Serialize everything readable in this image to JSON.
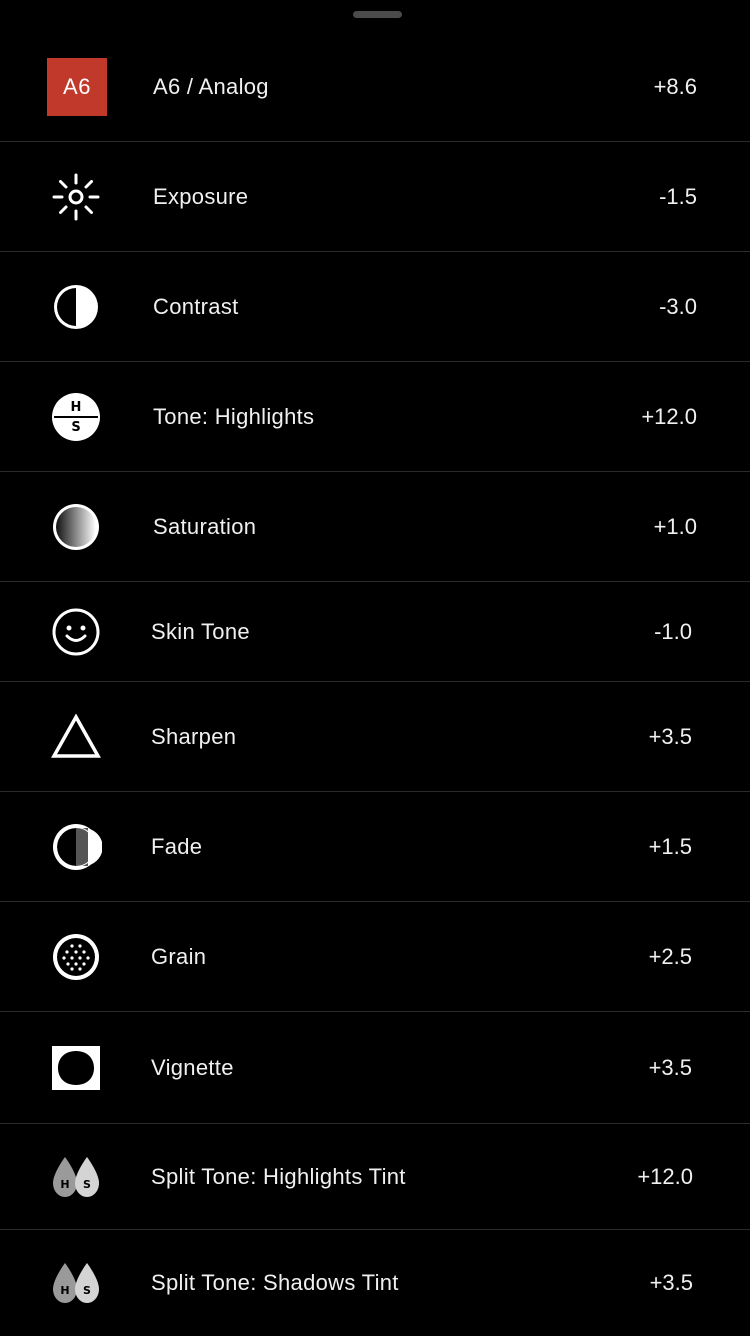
{
  "preset": {
    "badge": "A6",
    "label": "A6 / Analog",
    "value": "+8.6",
    "badge_color": "#c0392b"
  },
  "tools": [
    {
      "icon": "exposure-icon",
      "label": "Exposure",
      "value": "-1.5"
    },
    {
      "icon": "contrast-icon",
      "label": "Contrast",
      "value": "-3.0"
    },
    {
      "icon": "tone-icon",
      "label": "Tone: Highlights",
      "value": "+12.0",
      "icon_text_top": "H",
      "icon_text_bottom": "S"
    },
    {
      "icon": "saturation-icon",
      "label": "Saturation",
      "value": "+1.0"
    },
    {
      "icon": "skin-tone-icon",
      "label": "Skin Tone",
      "value": "-1.0"
    },
    {
      "icon": "sharpen-icon",
      "label": "Sharpen",
      "value": "+3.5"
    },
    {
      "icon": "fade-icon",
      "label": "Fade",
      "value": "+1.5"
    },
    {
      "icon": "grain-icon",
      "label": "Grain",
      "value": "+2.5"
    },
    {
      "icon": "vignette-icon",
      "label": "Vignette",
      "value": "+3.5"
    },
    {
      "icon": "split-tone-icon",
      "label": "Split Tone: Highlights Tint",
      "value": "+12.0",
      "icon_text_left": "H",
      "icon_text_right": "S"
    },
    {
      "icon": "split-tone-icon",
      "label": "Split Tone: Shadows Tint",
      "value": "+3.5",
      "icon_text_left": "H",
      "icon_text_right": "S"
    }
  ]
}
